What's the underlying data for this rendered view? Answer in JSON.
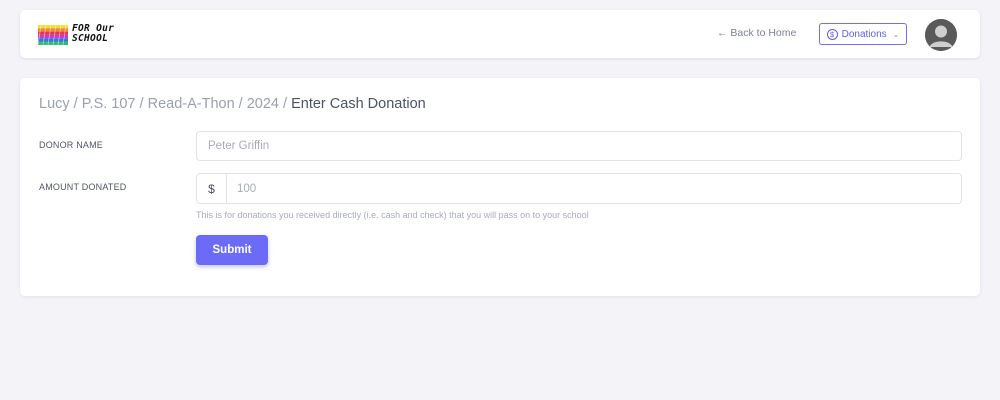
{
  "header": {
    "logo_text_line1": "FOR Our",
    "logo_text_line2": "SCHOOL",
    "back_link": "← Back to Home",
    "donations_button": "Donations",
    "donations_icon": "dollar-circle-icon",
    "avatar_icon": "user-avatar-icon"
  },
  "breadcrumb": {
    "items": [
      "Lucy",
      "P.S. 107",
      "Read-A-Thon",
      "2024"
    ],
    "separator": " / ",
    "current": "Enter Cash Donation"
  },
  "form": {
    "donor_name": {
      "label": "DONOR NAME",
      "placeholder": "Peter Griffin"
    },
    "amount": {
      "label": "AMOUNT DONATED",
      "prefix": "$",
      "placeholder": "100",
      "help": "This is for donations you received directly (i.e. cash and check) that you will pass on to your school"
    },
    "submit_label": "Submit"
  },
  "colors": {
    "accent": "#6b6bf7",
    "background": "#f3f3f8"
  }
}
